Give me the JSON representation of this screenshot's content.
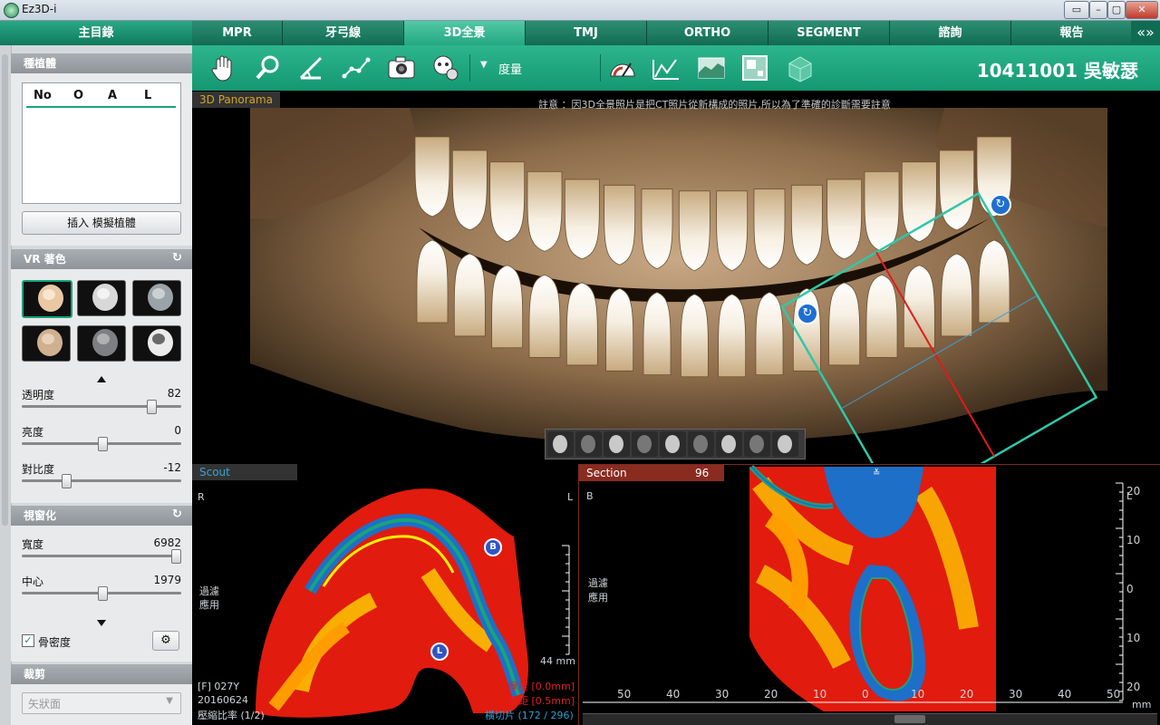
{
  "window": {
    "title": "Ez3D-i",
    "controls": [
      "▭",
      "–",
      "▢",
      "✕"
    ]
  },
  "left_panel": {
    "main_menu": "主目錄",
    "implant": {
      "header": "種植體",
      "columns": [
        "No",
        "O",
        "A",
        "L"
      ],
      "insert_button": "插入 模擬植體"
    },
    "vr": {
      "header": "VR 著色",
      "presets": [
        "vr-preset-skin-color",
        "vr-preset-bone-xray",
        "vr-preset-bone-gray",
        "vr-preset-skin-gray",
        "vr-preset-bone-dark",
        "vr-preset-skull-gear"
      ],
      "selected_preset": 0,
      "sliders": [
        {
          "label": "透明度",
          "value": "82",
          "level": 0.82
        },
        {
          "label": "亮度",
          "value": "0",
          "level": 0.5
        },
        {
          "label": "對比度",
          "value": "-12",
          "level": 0.26
        }
      ]
    },
    "window": {
      "header": "視窗化",
      "sliders": [
        {
          "label": "寬度",
          "value": "6982",
          "level": 0.98
        },
        {
          "label": "中心",
          "value": "1979",
          "level": 0.5
        }
      ],
      "bone_density_label": "骨密度",
      "bone_density_checked": true
    },
    "crop": {
      "header": "裁剪",
      "select_value": "矢狀面"
    }
  },
  "tabs": [
    {
      "label": "MPR",
      "active": false
    },
    {
      "label": "牙弓線",
      "active": false
    },
    {
      "label": "3D全景",
      "active": true
    },
    {
      "label": "TMJ",
      "active": false
    },
    {
      "label": "ORTHO",
      "active": false
    },
    {
      "label": "SEGMENT",
      "active": false
    },
    {
      "label": "諮詢",
      "active": false
    },
    {
      "label": "報告",
      "active": false
    }
  ],
  "tab_overflow": "«»",
  "toolbar": {
    "tools": [
      "hand-icon",
      "zoom-icon",
      "angle-icon",
      "polyline-icon",
      "camera-icon",
      "head-icon"
    ],
    "measure_label": "度量",
    "right_tools": [
      "gauge-icon",
      "histogram-icon",
      "profile-icon",
      "grid-icon",
      "cube-icon"
    ],
    "patient": "10411001 吳敏瑟"
  },
  "panorama": {
    "label": "3D Panorama",
    "notice": "註意 ：因3D全景照片是把CT照片從新構成的照片,所以為了準確的診斷需要註意",
    "view_buttons": [
      "face-front-icon",
      "face-left-icon",
      "face-right-icon",
      "face-back-icon",
      "face-up-icon",
      "face-down-icon",
      "face-top-icon",
      "face-bottom-icon",
      "rotate-icon"
    ]
  },
  "scout": {
    "label": "Scout",
    "left_marker": "R",
    "right_marker": "L",
    "filter_text": [
      "過濾",
      "應用"
    ],
    "scale_text": "44 mm",
    "info_lines": [
      "[F] 027Y",
      "20160624",
      "壓縮比率 (1/2)"
    ],
    "thickness_lines": [
      "厚度 [0.0mm]",
      "間距 [0.5mm]"
    ],
    "slice_text": "橫切片 (172 / 296)",
    "markers": [
      "B",
      "L"
    ]
  },
  "section": {
    "label": "Section",
    "number": "96",
    "left_marker": "B",
    "right_marker": "L",
    "filter_text": [
      "過濾",
      "應用"
    ],
    "right_ticks": [
      "20",
      "10",
      "0",
      "10",
      "20"
    ],
    "bottom_ticks": [
      "50",
      "40",
      "30",
      "20",
      "10",
      "0",
      "10",
      "20",
      "30",
      "40",
      "50"
    ],
    "unit": "mm"
  }
}
